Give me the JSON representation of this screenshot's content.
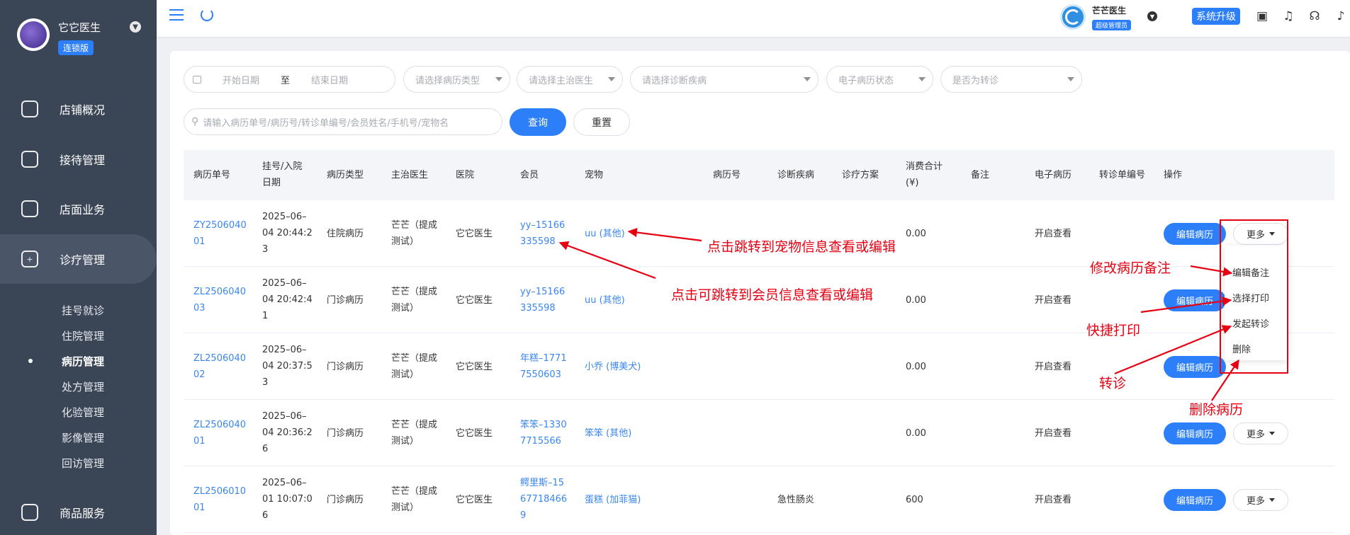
{
  "brand": {
    "name": "它它医生",
    "tag": "连锁版"
  },
  "nav": [
    {
      "label": "店铺概况",
      "icon": "dashboard-icon"
    },
    {
      "label": "接待管理",
      "icon": "reception-icon"
    },
    {
      "label": "店面业务",
      "icon": "store-icon"
    },
    {
      "label": "诊疗管理",
      "icon": "medical-kit-icon"
    },
    {
      "label": "商品服务",
      "icon": "goods-icon"
    }
  ],
  "subnav": [
    "挂号就诊",
    "住院管理",
    "病历管理",
    "处方管理",
    "化验管理",
    "影像管理",
    "回访管理"
  ],
  "topbar": {
    "user_name": "芒芒医生",
    "user_role": "超级管理员",
    "upgrade": "系统升级"
  },
  "filters": {
    "start_date": "开始日期",
    "date_sep": "至",
    "end_date": "结束日期",
    "record_type": "请选择病历类型",
    "doctor": "请选择主治医生",
    "disease": "请选择诊断疾病",
    "emr_status": "电子病历状态",
    "transfer": "是否为转诊",
    "search_placeholder": "请输入病历单号/病历号/转诊单编号/会员姓名/手机号/宠物名",
    "query": "查询",
    "reset": "重置"
  },
  "columns": [
    "病历单号",
    "挂号/入院日期",
    "病历类型",
    "主治医生",
    "医院",
    "会员",
    "宠物",
    "病历号",
    "诊断疾病",
    "诊疗方案",
    "消费合计(¥)",
    "备注",
    "电子病历",
    "转诊单编号",
    "操作"
  ],
  "header_lines": {
    "reg_date_1": "挂号/入院",
    "reg_date_2": "日期",
    "total_1": "消费合计",
    "total_2": "(¥)"
  },
  "rows": [
    {
      "id_1": "ZY2506040",
      "id_2": "01",
      "date_1": "2025–06–",
      "date_2": "04 20:44:2",
      "date_3": "3",
      "type": "住院病历",
      "doctor_1": "芒芒（提成",
      "doctor_2": "测试）",
      "hospital": "它它医生",
      "member_1": "yy–15166",
      "member_2": "335598",
      "member_3": "",
      "pet": "uu (其他)",
      "disease": "",
      "total": "0.00",
      "emr": "开启查看"
    },
    {
      "id_1": "ZL2506040",
      "id_2": "03",
      "date_1": "2025–06–",
      "date_2": "04 20:42:4",
      "date_3": "1",
      "type": "门诊病历",
      "doctor_1": "芒芒（提成",
      "doctor_2": "测试）",
      "hospital": "它它医生",
      "member_1": "yy–15166",
      "member_2": "335598",
      "member_3": "",
      "pet": "uu (其他)",
      "disease": "",
      "total": "0.00",
      "emr": "开启查看"
    },
    {
      "id_1": "ZL2506040",
      "id_2": "02",
      "date_1": "2025–06–",
      "date_2": "04 20:37:5",
      "date_3": "3",
      "type": "门诊病历",
      "doctor_1": "芒芒（提成",
      "doctor_2": "测试）",
      "hospital": "它它医生",
      "member_1": "年糕–1771",
      "member_2": "7550603",
      "member_3": "",
      "pet": "小乔 (博美犬)",
      "disease": "",
      "total": "0.00",
      "emr": "开启查看"
    },
    {
      "id_1": "ZL2506040",
      "id_2": "01",
      "date_1": "2025–06–",
      "date_2": "04 20:36:2",
      "date_3": "6",
      "type": "门诊病历",
      "doctor_1": "芒芒（提成",
      "doctor_2": "测试）",
      "hospital": "它它医生",
      "member_1": "笨笨–1330",
      "member_2": "7715566",
      "member_3": "",
      "pet": "笨笨 (其他)",
      "disease": "",
      "total": "0.00",
      "emr": "开启查看"
    },
    {
      "id_1": "ZL2506010",
      "id_2": "01",
      "date_1": "2025–06–",
      "date_2": "01 10:07:0",
      "date_3": "6",
      "type": "门诊病历",
      "doctor_1": "芒芒（提成",
      "doctor_2": "测试）",
      "hospital": "它它医生",
      "member_1": "鳄里斯–15",
      "member_2": "67718466",
      "member_3": "9",
      "pet": "蛋糕 (加菲猫)",
      "disease": "急性肠炎",
      "total": "600",
      "emr": "开启查看"
    }
  ],
  "row_actions": {
    "edit": "编辑病历",
    "more": "更多"
  },
  "dropdown": [
    "编辑备注",
    "选择打印",
    "发起转诊",
    "删除"
  ],
  "annotations": {
    "pet_link": "点击跳转到宠物信息查看或编辑",
    "member_link": "点击可跳转到会员信息查看或编辑",
    "edit_note": "修改病历备注",
    "quick_print": "快捷打印",
    "transfer": "转诊",
    "delete": "删除病历"
  },
  "colors": {
    "sidebar": "#3a4556",
    "primary": "#2d7ff9",
    "annotation": "#e60012",
    "link": "#3a86f0"
  }
}
